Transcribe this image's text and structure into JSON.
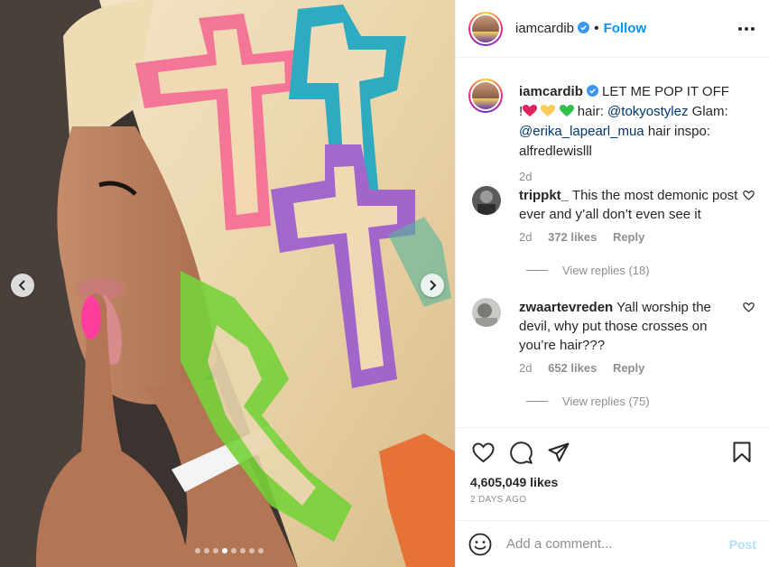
{
  "post": {
    "image_alt": "woman with long blonde hair dyed with colorful cross patterns",
    "carousel": {
      "total": 8,
      "active_index": 3
    }
  },
  "header": {
    "username": "iamcardib",
    "separator": "•",
    "follow_label": "Follow"
  },
  "caption": {
    "username": "iamcardib",
    "text_1": "LET ME POP IT OFF !",
    "text_2": "hair:",
    "mention_1": "@tokyostylez",
    "text_3": "Glam:",
    "mention_2": "@erika_lapearl_mua",
    "text_4": "hair inspo: alfredlewislll",
    "time": "2d",
    "emojis": [
      "red-heart",
      "yellow-heart",
      "green-heart"
    ]
  },
  "comments": [
    {
      "username": "trippkt_",
      "text": "This the most demonic post ever and y’all don’t even see it",
      "time": "2d",
      "likes": "372 likes",
      "reply_label": "Reply",
      "view_replies": "View replies (18)"
    },
    {
      "username": "zwaartevreden",
      "text": "Yall worship the devil, why put those crosses on you’re hair???",
      "time": "2d",
      "likes": "652 likes",
      "reply_label": "Reply",
      "view_replies": "View replies (75)"
    }
  ],
  "actions": {
    "likes": "4,605,049 likes",
    "time_ago": "2 DAYS AGO",
    "icons": [
      "heart-icon",
      "comment-icon",
      "share-icon",
      "bookmark-icon"
    ]
  },
  "add_comment": {
    "placeholder": "Add a comment...",
    "post_label": "Post"
  },
  "colors": {
    "accent_blue": "#0095f6",
    "mention_blue": "#00376b",
    "muted": "#8e8e8e",
    "post_disabled": "#b2dffc"
  }
}
